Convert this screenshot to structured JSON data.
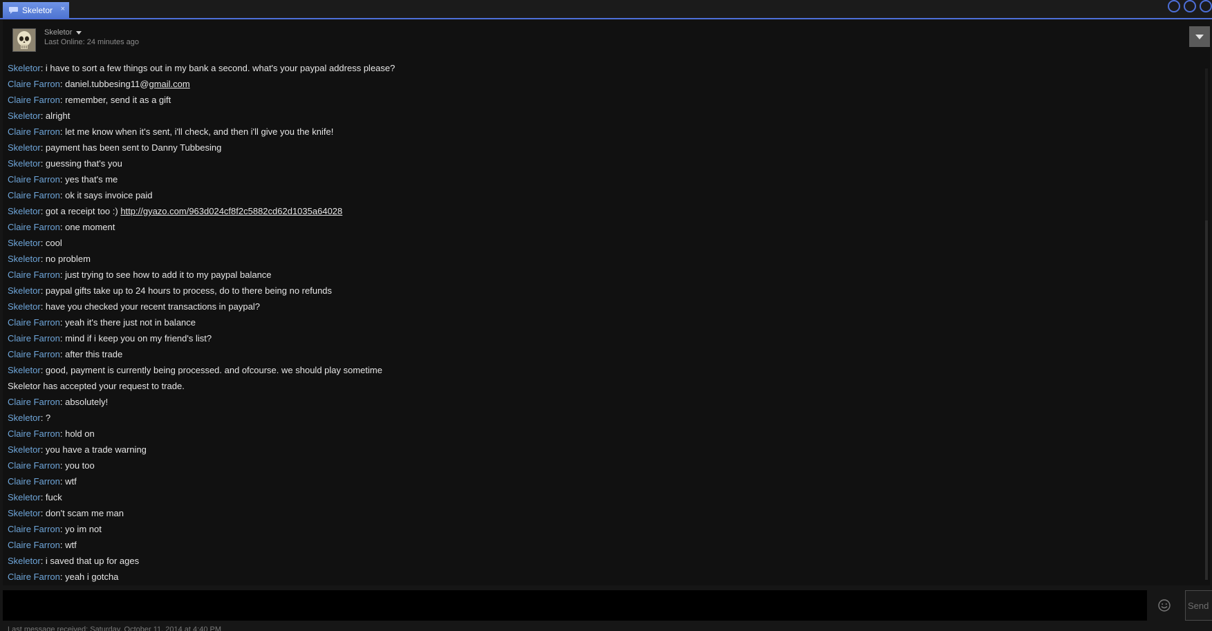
{
  "tab": {
    "title": "Skeletor",
    "close": "×"
  },
  "header": {
    "friend_name": "Skeletor",
    "last_online": "Last Online: 24 minutes ago"
  },
  "messages": [
    {
      "sender": "Skeletor",
      "text": ": i have to sort a few things out in my bank a second. what's your paypal address please?"
    },
    {
      "sender": "Claire Farron",
      "text": ": daniel.tubbesing11@",
      "link": "gmail.com"
    },
    {
      "sender": "Claire Farron",
      "text": ": remember, send it as a gift"
    },
    {
      "sender": "Skeletor",
      "text": ": alright"
    },
    {
      "sender": "Claire Farron",
      "text": ": let me know when it's sent, i'll check, and then i'll give you the knife!"
    },
    {
      "sender": "Skeletor",
      "text": ": payment has been sent to Danny Tubbesing"
    },
    {
      "sender": "Skeletor",
      "text": ": guessing that's you"
    },
    {
      "sender": "Claire Farron",
      "text": ": yes that's me"
    },
    {
      "sender": "Claire Farron",
      "text": ": ok it says invoice paid"
    },
    {
      "sender": "Skeletor",
      "text": ": got a receipt too :) ",
      "link": "http://gyazo.com/963d024cf8f2c5882cd62d1035a64028"
    },
    {
      "sender": "Claire Farron",
      "text": ": one moment"
    },
    {
      "sender": "Skeletor",
      "text": ": cool"
    },
    {
      "sender": "Skeletor",
      "text": ": no problem"
    },
    {
      "sender": "Claire Farron",
      "text": ": just trying to see how to add it to my paypal balance"
    },
    {
      "sender": "Skeletor",
      "text": ": paypal gifts take up to 24 hours to process, do to there being no refunds"
    },
    {
      "sender": "Skeletor",
      "text": ": have you checked your recent transactions in paypal?"
    },
    {
      "sender": "Claire Farron",
      "text": ": yeah it's there just not in balance"
    },
    {
      "sender": "Claire Farron",
      "text": ": mind if i keep you on my friend's list?"
    },
    {
      "sender": "Claire Farron",
      "text": ": after this trade"
    },
    {
      "sender": "Skeletor",
      "text": ": good, payment is currently being processed. and ofcourse. we should play sometime"
    },
    {
      "sender": "",
      "text": "Skeletor has accepted your request to trade."
    },
    {
      "sender": "Claire Farron",
      "text": ": absolutely!"
    },
    {
      "sender": "Skeletor",
      "text": ": ?"
    },
    {
      "sender": "Claire Farron",
      "text": ": hold on"
    },
    {
      "sender": "Skeletor",
      "text": ": you have a trade warning"
    },
    {
      "sender": "Claire Farron",
      "text": ": you too"
    },
    {
      "sender": "Claire Farron",
      "text": ": wtf"
    },
    {
      "sender": "Skeletor",
      "text": ": fuck"
    },
    {
      "sender": "Skeletor",
      "text": ": don't scam me man"
    },
    {
      "sender": "Claire Farron",
      "text": ": yo im not"
    },
    {
      "sender": "Claire Farron",
      "text": ": wtf"
    },
    {
      "sender": "Skeletor",
      "text": ": i saved that up for ages"
    },
    {
      "sender": "Claire Farron",
      "text": ": yeah i gotcha"
    }
  ],
  "compose": {
    "input_value": "",
    "send_label": "Send",
    "emoji_icon": "smiley-icon"
  },
  "footer": {
    "last_message": "Last message received: Saturday, October 11, 2014 at 4:40 PM"
  },
  "colors": {
    "accent": "#4d6fd8",
    "sender": "#6fa6da",
    "background": "#111111"
  }
}
